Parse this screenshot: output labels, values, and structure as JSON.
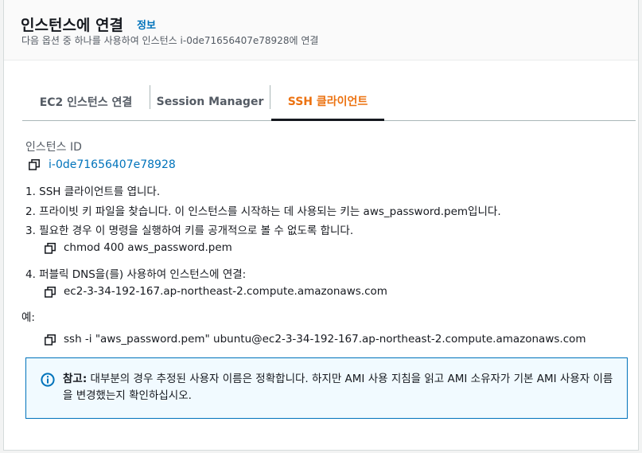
{
  "header": {
    "title": "인스턴스에 연결",
    "info_link": "정보",
    "subtitle": "다음 옵션 중 하나를 사용하여 인스턴스 i-0de71656407e78928에 연결"
  },
  "tabs": [
    {
      "label": "EC2 인스턴스 연결"
    },
    {
      "label": "Session Manager"
    },
    {
      "label": "SSH 클라이언트"
    }
  ],
  "instance": {
    "label": "인스턴스 ID",
    "id": "i-0de71656407e78928"
  },
  "steps": {
    "s1": "1. SSH 클라이언트를 엽니다.",
    "s2": "2. 프라이빗 키 파일을 찾습니다. 이 인스턴스를 시작하는 데 사용되는 키는 aws_password.pem입니다.",
    "s3": "3. 필요한 경우 이 명령을 실행하여 키를 공개적으로 볼 수 없도록 합니다.",
    "s3_cmd": "chmod 400 aws_password.pem",
    "s4": "4. 퍼블릭 DNS을(를) 사용하여 인스턴스에 연결:",
    "s4_dns": "ec2-3-34-192-167.ap-northeast-2.compute.amazonaws.com",
    "example_label": "예:",
    "example_cmd": "ssh -i \"aws_password.pem\" ubuntu@ec2-3-34-192-167.ap-northeast-2.compute.amazonaws.com"
  },
  "note": {
    "title": "참고:",
    "text": "대부분의 경우 추정된 사용자 이름은 정확합니다. 하지만 AMI 사용 지침을 읽고 AMI 소유자가 기본 AMI 사용자 이름을 변경했는지 확인하십시오."
  },
  "colors": {
    "accent": "#ec7211",
    "link": "#0073bb",
    "info_bg": "#f1faff"
  }
}
